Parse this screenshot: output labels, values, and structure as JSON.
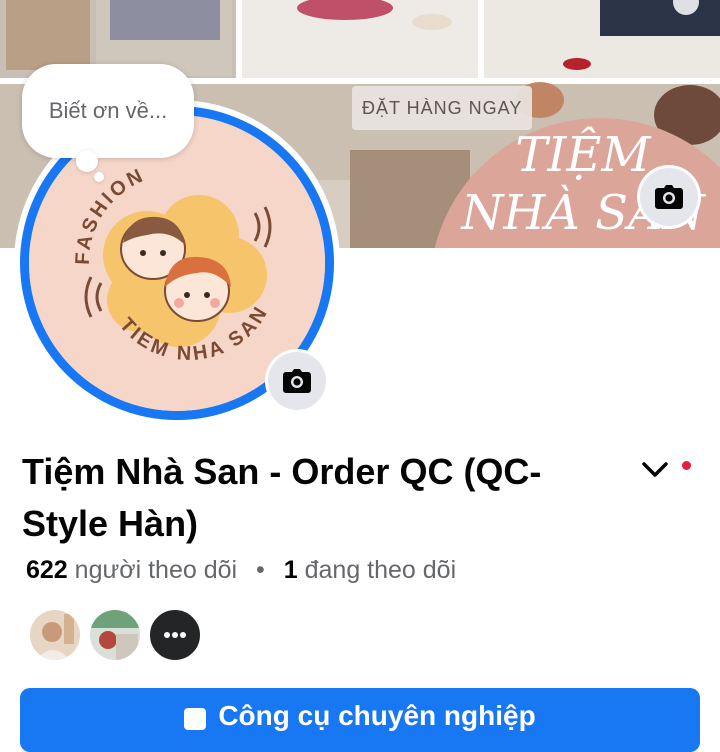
{
  "cover": {
    "cta_label": "ĐẶT HÀNG NGAY",
    "brand_text": "TIỆM NHÀ SAN"
  },
  "avatar": {
    "note_placeholder": "Biết ơn về...",
    "logo_top_text": "FASHION",
    "logo_bottom_text": "TIEM NHA SAN"
  },
  "profile": {
    "name": "Tiệm Nhà San - Order QC (QC-Style Hàn)",
    "followers_count": "622",
    "followers_label": "người theo dõi",
    "separator": "•",
    "following_count": "1",
    "following_label": "đang theo dõi"
  },
  "actions": {
    "primary_label": "Công cụ chuyên nghiệp"
  },
  "icons": {
    "cover_camera": "camera-icon",
    "avatar_camera": "camera-icon",
    "menu_chevron": "chevron-down-icon",
    "more_friends": "more-dots-icon"
  },
  "colors": {
    "accent": "#1877f2",
    "notification": "#e41e3f",
    "cover_arch": "#dca59a",
    "logo_bg": "#f6d6c9",
    "secondary_text": "#65676b"
  }
}
